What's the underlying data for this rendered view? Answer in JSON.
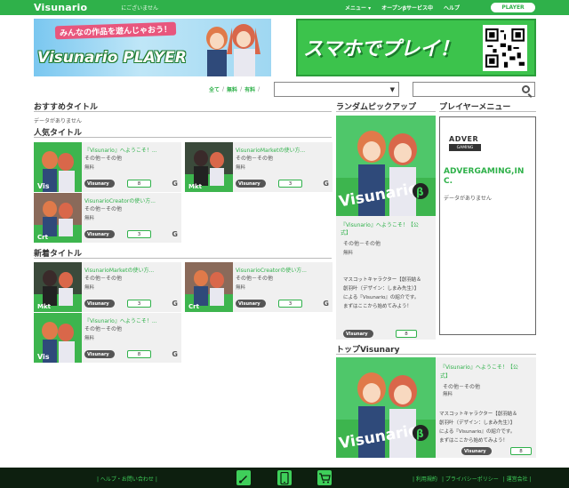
{
  "header": {
    "logo": "Visunario",
    "login_status": "にございません",
    "nav": [
      "メニュー ▾",
      "オープンβサービス中",
      "ヘルプ"
    ],
    "player_button": "PLAYER"
  },
  "banners": {
    "left_catch": "みんなの作品を遊んじゃおう！",
    "left_title": "Visunario PLAYER",
    "right_title": "スマホでプレイ！"
  },
  "filters": {
    "all": "全て",
    "free": "無料",
    "paid": "有料",
    "sep": "/",
    "select_arrow": "▼"
  },
  "sections": {
    "recommended": "おすすめタイトル",
    "no_data": "データがありません",
    "popular": "人気タイトル",
    "new": "新着タイトル",
    "random_pickup": "ランダムピックアップ",
    "player_menu": "プレイヤーメニュー",
    "top_visunary": "トップVisunary"
  },
  "popular_cards": [
    {
      "title": "『Visunario』へようこそ！...",
      "genre": "その他－その他",
      "price": "無料",
      "badge": "Visunary",
      "count": "8",
      "g": "G"
    },
    {
      "title": "VisunarioMarketの使い方...",
      "genre": "その他－その他",
      "price": "無料",
      "badge": "Visunary",
      "count": "3",
      "g": "G"
    },
    {
      "title": "VisunarioCreatorの使い方...",
      "genre": "その他－その他",
      "price": "無料",
      "badge": "Visunary",
      "count": "3",
      "g": "G"
    }
  ],
  "new_cards": [
    {
      "title": "VisunarioMarketの使い方...",
      "genre": "その他－その他",
      "price": "無料",
      "badge": "Visunary",
      "count": "3",
      "g": "G"
    },
    {
      "title": "VisunarioCreatorの使い方...",
      "genre": "その他－その他",
      "price": "無料",
      "badge": "Visunary",
      "count": "3",
      "g": "G"
    },
    {
      "title": "『Visunario』へようこそ！...",
      "genre": "その他－その他",
      "price": "無料",
      "badge": "Visunary",
      "count": "8",
      "g": "G"
    }
  ],
  "pickup": {
    "title_line1": "『Visunario』へようこそ！【公",
    "title_line2": "式】",
    "genre": "その他－その他",
    "price": "無料",
    "desc": [
      "マスコットキャラクター【創羽結＆",
      "創羽叶（デザイン：しまみ先生）】",
      "による『Visunario』の紹介です。",
      "まずはここから始めてみよう！"
    ],
    "badge": "Visunary",
    "count": "8"
  },
  "player_menu": {
    "logo_top": "ADVER",
    "logo_bottom": "GAMING",
    "name": "ADVERGAMING,INC.",
    "no_data": "データがありません"
  },
  "top_visunary": {
    "title_line1": "『Visunario』へようこそ！【公",
    "title_line2": "式】",
    "genre": "その他－その他",
    "price": "無料",
    "desc": [
      "マスコットキャラクター【創羽結＆",
      "創羽叶（デザイン：しまみ先生）】",
      "による『Visunario』の紹介です。",
      "まずはここから始めてみよう！"
    ],
    "badge": "Visunary",
    "count": "8"
  },
  "footer": {
    "left": "| ヘルプ・お問い合わせ |",
    "right": [
      "| 利用規約",
      "| プライバシーポリシー",
      "| 運営会社 |"
    ]
  }
}
